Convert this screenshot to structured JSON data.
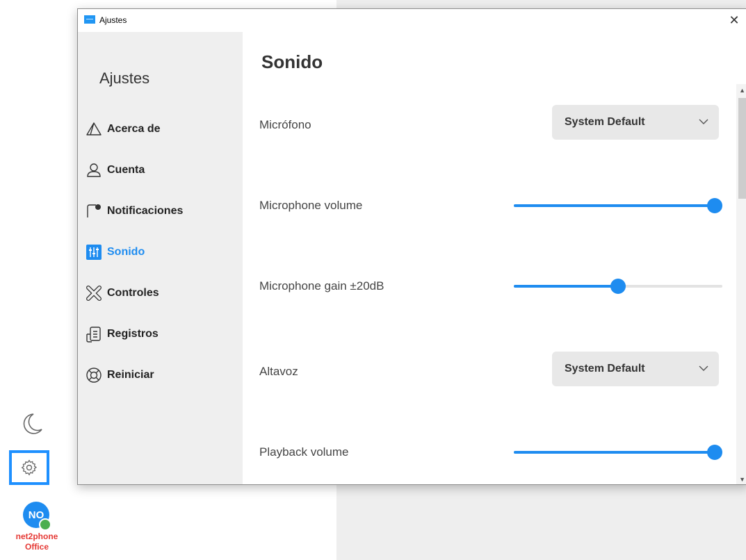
{
  "window": {
    "title": "Ajustes",
    "close_glyph": "✕"
  },
  "sidebar": {
    "title": "Ajustes",
    "items": [
      {
        "label": "Acerca de",
        "icon": "triangle-icon"
      },
      {
        "label": "Cuenta",
        "icon": "user-icon"
      },
      {
        "label": "Notificaciones",
        "icon": "notification-icon"
      },
      {
        "label": "Sonido",
        "icon": "sliders-icon",
        "active": true
      },
      {
        "label": "Controles",
        "icon": "controls-icon"
      },
      {
        "label": "Registros",
        "icon": "logs-icon"
      },
      {
        "label": "Reiniciar",
        "icon": "lifebuoy-icon"
      }
    ]
  },
  "content": {
    "title": "Sonido",
    "microphone": {
      "label": "Micrófono",
      "value": "System Default"
    },
    "microphone_volume": {
      "label": "Microphone volume",
      "percent": 100
    },
    "microphone_gain": {
      "label": "Microphone gain ±20dB",
      "percent": 52
    },
    "speaker": {
      "label": "Altavoz",
      "value": "System Default"
    },
    "playback_volume": {
      "label": "Playback volume",
      "percent": 100
    }
  },
  "rail": {
    "avatar_initials": "NO",
    "brand_line1": "net2phone",
    "brand_line2": "Office"
  },
  "colors": {
    "accent": "#1e8cf0",
    "brand": "#e53935",
    "presence": "#4caf50"
  }
}
